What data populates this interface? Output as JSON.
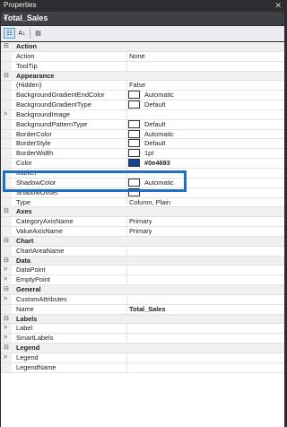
{
  "window": {
    "title": "Properties",
    "close_glyph": "✕"
  },
  "object": {
    "name": "Total_Sales",
    "dropdown_glyph": "▾"
  },
  "toolbar": [
    {
      "name": "categorized-view-icon",
      "glyph": "☷",
      "active": true
    },
    {
      "name": "sort-alphabetical-icon",
      "glyph": "A↓",
      "active": false
    },
    {
      "name": "property-pages-icon",
      "glyph": "▤",
      "active": false
    }
  ],
  "rows": [
    {
      "type": "cat",
      "name": "Action"
    },
    {
      "type": "prop",
      "name": "Action",
      "value": "None"
    },
    {
      "type": "prop",
      "name": "ToolTip",
      "value": ""
    },
    {
      "type": "cat",
      "name": "Appearance"
    },
    {
      "type": "prop",
      "name": "(Hidden)",
      "value": "False"
    },
    {
      "type": "prop",
      "name": "BackgroundGradientEndColor",
      "value": "Automatic",
      "swatch": "#ffffff"
    },
    {
      "type": "prop",
      "name": "BackgroundGradientType",
      "value": "Default",
      "swatch": "#ffffff"
    },
    {
      "type": "prop",
      "name": "BackgroundImage",
      "value": "",
      "expander": ">"
    },
    {
      "type": "prop",
      "name": "BackgroundPatternType",
      "value": "Default",
      "swatch": "#ffffff"
    },
    {
      "type": "prop",
      "name": "BorderColor",
      "value": "Automatic",
      "swatch": "#ffffff"
    },
    {
      "type": "prop",
      "name": "BorderStyle",
      "value": "Default",
      "swatch": "#ffffff"
    },
    {
      "type": "prop",
      "name": "BorderWidth",
      "value": "1pt",
      "swatch": "#ffffff"
    },
    {
      "type": "prop",
      "name": "Color",
      "value": "#0e4693",
      "swatch": "#0e4693",
      "bold": true
    },
    {
      "type": "prop",
      "name": "Marker",
      "value": "",
      "expander": ">"
    },
    {
      "type": "prop",
      "name": "ShadowColor",
      "value": "Automatic",
      "swatch": "#ffffff"
    },
    {
      "type": "prop",
      "name": "ShadowOffset",
      "value": "",
      "swatch": "#ffffff"
    },
    {
      "type": "prop",
      "name": "Type",
      "value": "Column, Plain"
    },
    {
      "type": "cat",
      "name": "Axes"
    },
    {
      "type": "prop",
      "name": "CategoryAxisName",
      "value": "Primary"
    },
    {
      "type": "prop",
      "name": "ValueAxisName",
      "value": "Primary"
    },
    {
      "type": "cat",
      "name": "Chart"
    },
    {
      "type": "prop",
      "name": "ChartAreaName",
      "value": ""
    },
    {
      "type": "cat",
      "name": "Data"
    },
    {
      "type": "prop",
      "name": "DataPoint",
      "value": "",
      "expander": ">"
    },
    {
      "type": "prop",
      "name": "EmptyPoint",
      "value": "",
      "expander": ">"
    },
    {
      "type": "cat",
      "name": "General"
    },
    {
      "type": "prop",
      "name": "CustomAttributes",
      "value": "",
      "expander": ">"
    },
    {
      "type": "prop",
      "name": "Name",
      "value": "Total_Sales",
      "bold": true
    },
    {
      "type": "cat",
      "name": "Labels"
    },
    {
      "type": "prop",
      "name": "Label",
      "value": "",
      "expander": ">"
    },
    {
      "type": "prop",
      "name": "SmartLabels",
      "value": "",
      "expander": ">"
    },
    {
      "type": "cat",
      "name": "Legend"
    },
    {
      "type": "prop",
      "name": "Legend",
      "value": "",
      "expander": ">"
    },
    {
      "type": "prop",
      "name": "LegendName",
      "value": ""
    }
  ],
  "highlight_color": "#1f6fc5",
  "category_expander_glyph": "⊟"
}
